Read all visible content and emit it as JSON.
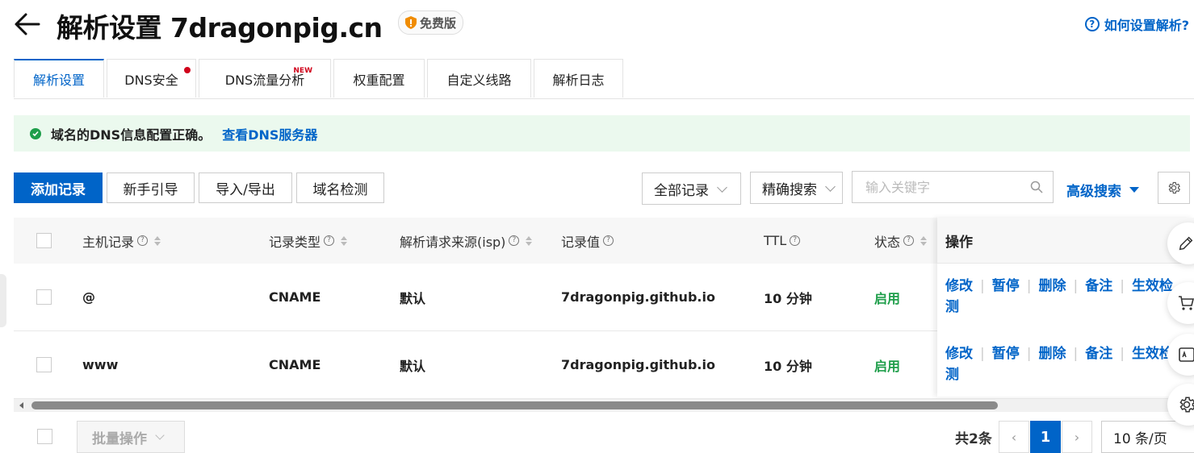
{
  "header": {
    "title": "解析设置 7dragonpig.cn",
    "badge": "免费版",
    "help": "如何设置解析?"
  },
  "tabs": [
    {
      "label": "解析设置",
      "active": true
    },
    {
      "label": "DNS安全",
      "dot": true
    },
    {
      "label": "DNS流量分析",
      "tag": "NEW"
    },
    {
      "label": "权重配置"
    },
    {
      "label": "自定义线路"
    },
    {
      "label": "解析日志"
    }
  ],
  "notice": {
    "message": "域名的DNS信息配置正确。",
    "link": "查看DNS服务器"
  },
  "toolbar": {
    "add": "添加记录",
    "guide": "新手引导",
    "import_export": "导入/导出",
    "check": "域名检测",
    "filter": "全部记录",
    "search_mode": "精确搜索",
    "search_placeholder": "输入关键字",
    "advanced": "高级搜索"
  },
  "table": {
    "columns": {
      "host": "主机记录",
      "type": "记录类型",
      "isp": "解析请求来源(isp)",
      "value": "记录值",
      "ttl": "TTL",
      "status": "状态",
      "ops": "操作"
    },
    "rows": [
      {
        "host": "@",
        "type": "CNAME",
        "isp": "默认",
        "value": "7dragonpig.github.io",
        "ttl": "10 分钟",
        "status": "启用"
      },
      {
        "host": "www",
        "type": "CNAME",
        "isp": "默认",
        "value": "7dragonpig.github.io",
        "ttl": "10 分钟",
        "status": "启用"
      }
    ],
    "actions": {
      "edit": "修改",
      "pause": "暂停",
      "delete": "删除",
      "note": "备注",
      "detect_1": "生效检",
      "detect_2": "测"
    }
  },
  "footer": {
    "batch": "批量操作",
    "total": "共2条",
    "page": "1",
    "page_size": "10 条/页"
  },
  "colors": {
    "primary": "#0064c8",
    "success": "#1e9e4a",
    "notice_bg": "#ebf9ee",
    "alert_red": "#d0021b"
  }
}
